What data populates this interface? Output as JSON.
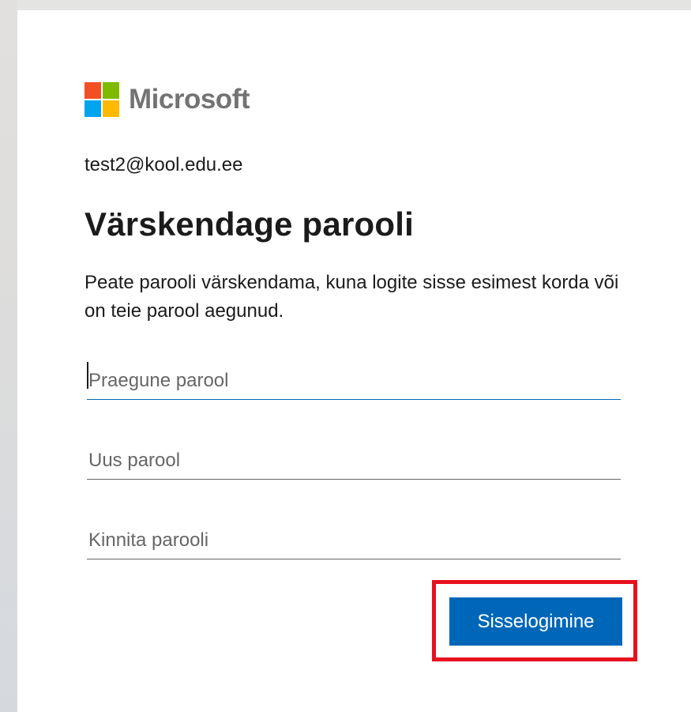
{
  "brand": {
    "name": "Microsoft",
    "logo_colors": {
      "red": "#f25022",
      "green": "#7fba00",
      "blue": "#00a4ef",
      "yellow": "#ffb900"
    }
  },
  "identity": {
    "email": "test2@kool.edu.ee"
  },
  "heading": {
    "title": "Värskendage parooli"
  },
  "description": {
    "text": "Peate parooli värskendama, kuna logite sisse esimest korda või on teie parool aegunud."
  },
  "form": {
    "current_password": {
      "placeholder": "Praegune parool",
      "value": ""
    },
    "new_password": {
      "placeholder": "Uus parool",
      "value": ""
    },
    "confirm_password": {
      "placeholder": "Kinnita parooli",
      "value": ""
    }
  },
  "actions": {
    "signin_label": "Sisselogimine"
  },
  "colors": {
    "accent": "#0067b8",
    "highlight": "#e8101e",
    "text": "#1b1b1b"
  }
}
